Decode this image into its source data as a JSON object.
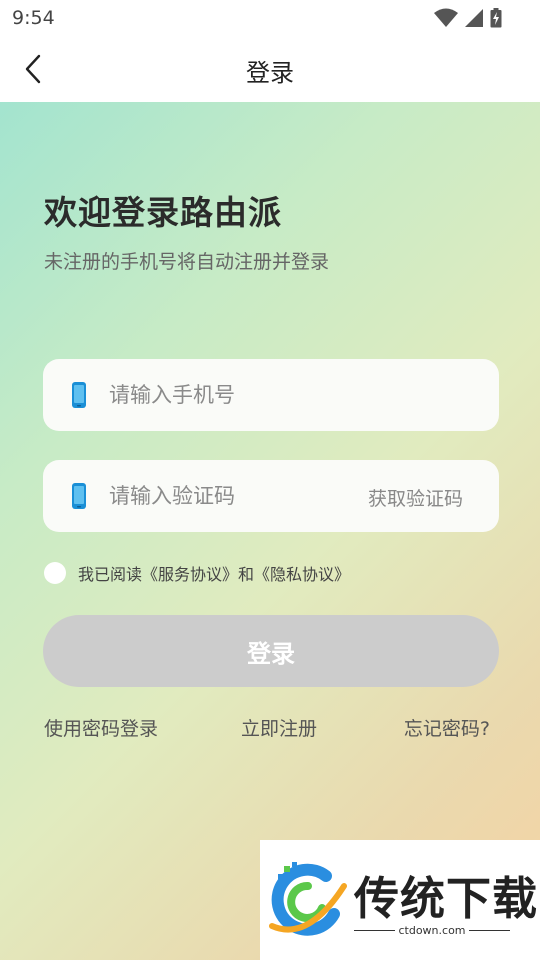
{
  "status_bar": {
    "time": "9:54"
  },
  "app_bar": {
    "title": "登录"
  },
  "welcome": {
    "title": "欢迎登录路由派",
    "subtitle": "未注册的手机号将自动注册并登录"
  },
  "phone_input": {
    "placeholder": "请输入手机号",
    "value": ""
  },
  "code_input": {
    "placeholder": "请输入验证码",
    "value": "",
    "get_code_label": "获取验证码"
  },
  "agreement": {
    "prefix": "我已阅读",
    "service_link": "《服务协议》",
    "and": "和",
    "privacy_link": "《隐私协议》"
  },
  "login_button": {
    "label": "登录"
  },
  "links": {
    "password_login": "使用密码登录",
    "register": "立即注册",
    "forgot": "忘记密码?"
  },
  "watermark": {
    "name": "传统下载",
    "domain": "ctdown.com"
  },
  "colors": {
    "button_disabled": "#cccccc",
    "gradient_start": "#a3e4cf",
    "gradient_end": "#f6d3a3",
    "phone_icon": "#1a8fd6"
  }
}
